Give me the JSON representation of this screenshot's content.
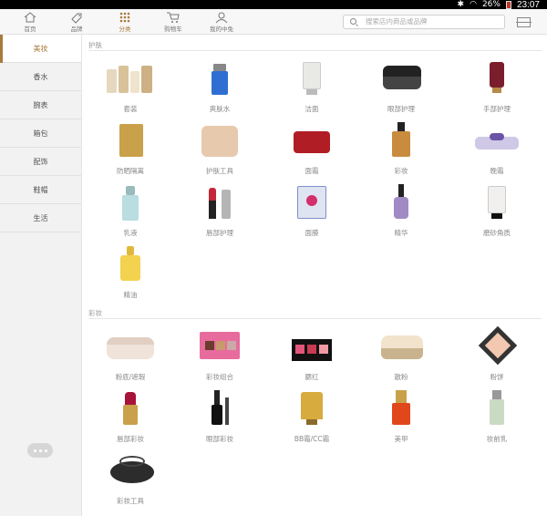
{
  "status": {
    "battery": "26%",
    "time": "23:07"
  },
  "nav": {
    "items": [
      {
        "label": "首页",
        "icon": "home-icon"
      },
      {
        "label": "品牌",
        "icon": "tag-icon"
      },
      {
        "label": "分类",
        "icon": "grid-icon"
      },
      {
        "label": "购物车",
        "icon": "cart-icon"
      },
      {
        "label": "我的中免",
        "icon": "user-icon"
      }
    ],
    "active": "分类",
    "search_placeholder": "搜索店内商品或品牌"
  },
  "sidebar": {
    "items": [
      {
        "label": "美妆"
      },
      {
        "label": "香水"
      },
      {
        "label": "腕表"
      },
      {
        "label": "箱包"
      },
      {
        "label": "配饰"
      },
      {
        "label": "鞋帽"
      },
      {
        "label": "生活"
      }
    ],
    "active": "美妆"
  },
  "sections": [
    {
      "title": "护肤",
      "items": [
        {
          "label": "套装"
        },
        {
          "label": "爽肤水"
        },
        {
          "label": "洁面"
        },
        {
          "label": "眼部护理"
        },
        {
          "label": "手部护理"
        },
        {
          "label": "防晒隔离"
        },
        {
          "label": "护肤工具"
        },
        {
          "label": "面霜"
        },
        {
          "label": "彩妆"
        },
        {
          "label": "晚霜"
        },
        {
          "label": "乳液"
        },
        {
          "label": "唇部护理"
        },
        {
          "label": "面膜"
        },
        {
          "label": "精华"
        },
        {
          "label": "磨砂角质"
        },
        {
          "label": "精油"
        }
      ]
    },
    {
      "title": "彩妆",
      "items": [
        {
          "label": "粉底/遮瑕"
        },
        {
          "label": "彩妆组合"
        },
        {
          "label": "腮红"
        },
        {
          "label": "散粉"
        },
        {
          "label": "粉饼"
        },
        {
          "label": "唇部彩妆"
        },
        {
          "label": "眼部彩妆"
        },
        {
          "label": "BB霜/CC霜"
        },
        {
          "label": "美甲"
        },
        {
          "label": "妆前乳"
        },
        {
          "label": "彩妆工具"
        }
      ]
    }
  ],
  "colors": {
    "accent": "#a87a3d",
    "sidebar_bg": "#f2f2f2",
    "statusbar": "#000000"
  }
}
